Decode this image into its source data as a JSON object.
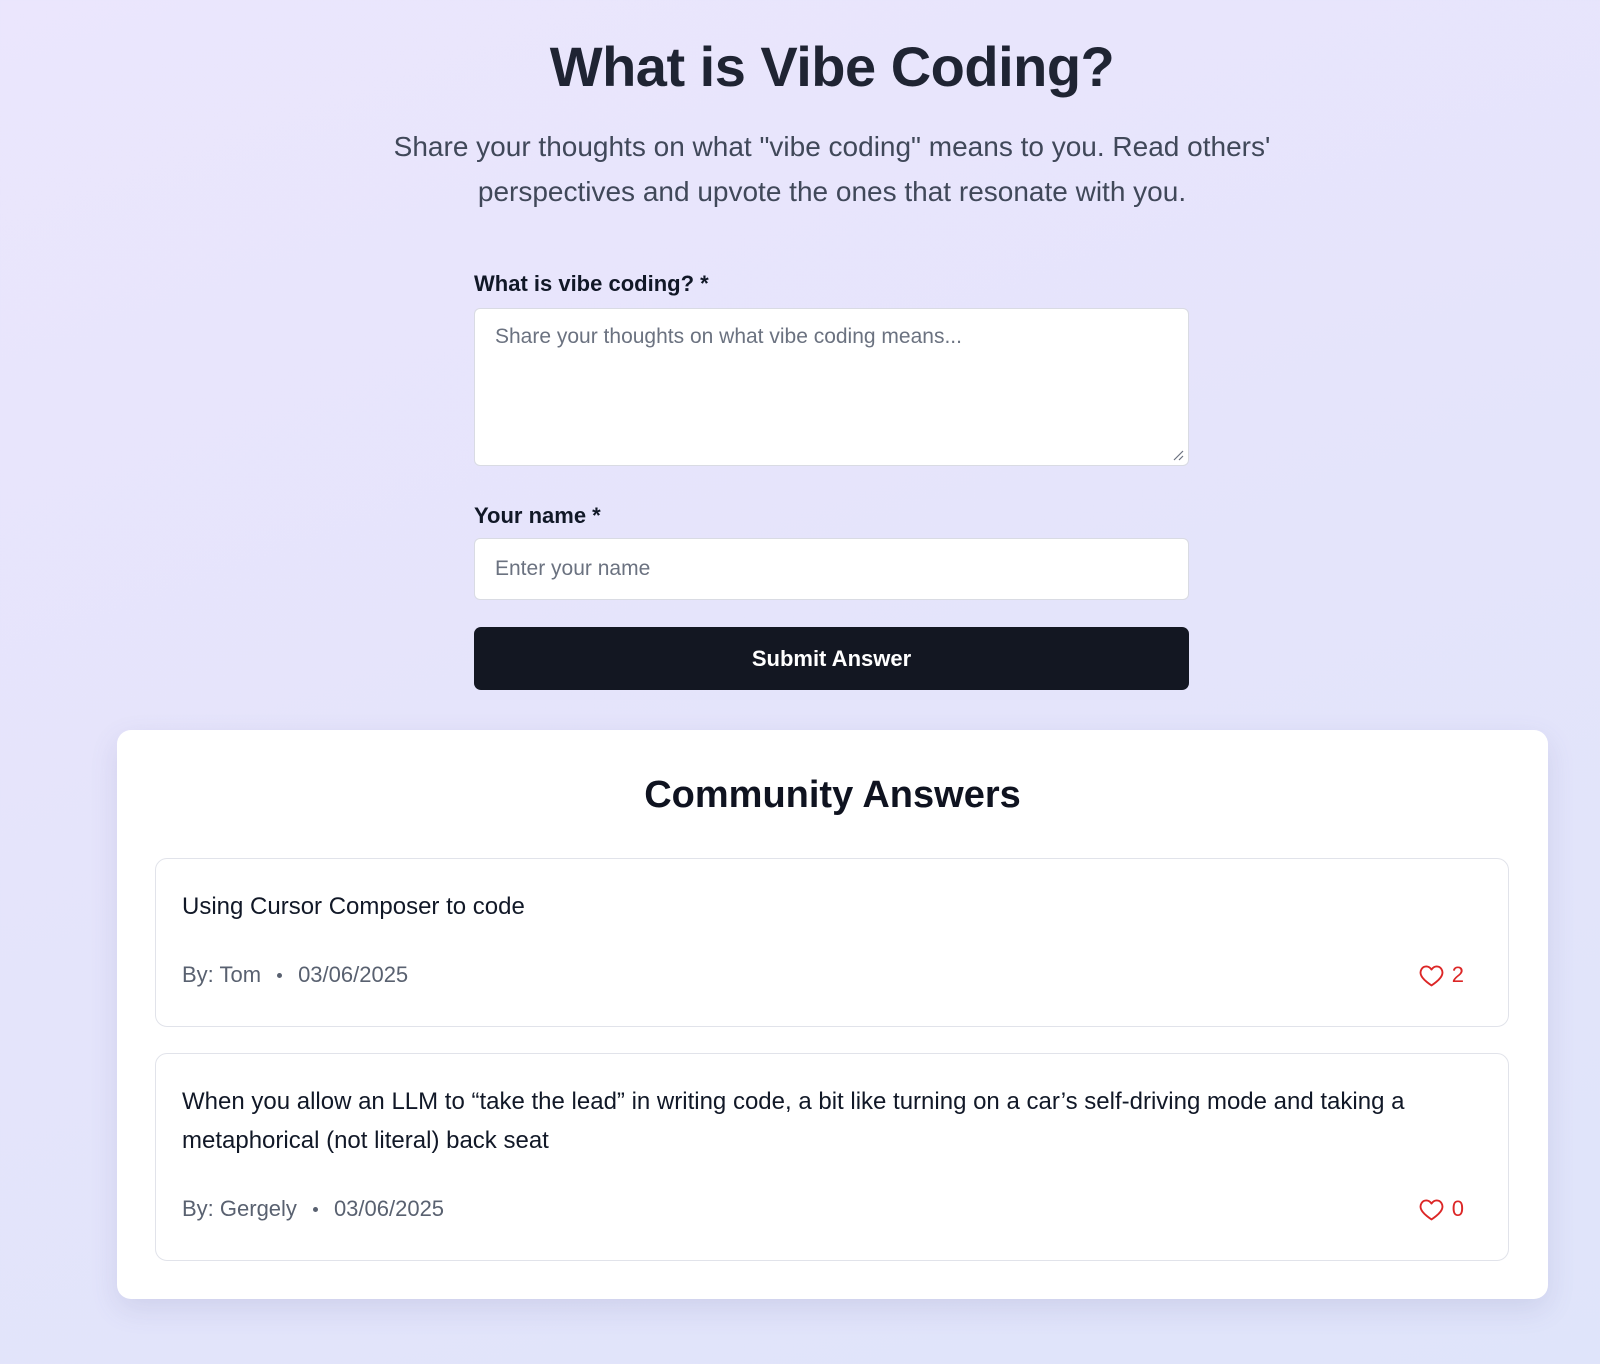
{
  "hero": {
    "title": "What is Vibe Coding?",
    "subtitle": "Share your thoughts on what \"vibe coding\" means to you. Read others' perspectives and upvote the ones that resonate with you."
  },
  "form": {
    "answer_label": "What is vibe coding? *",
    "answer_placeholder": "Share your thoughts on what vibe coding means...",
    "answer_value": "",
    "name_label": "Your name *",
    "name_placeholder": "Enter your name",
    "name_value": "",
    "submit_label": "Submit Answer"
  },
  "answers_section": {
    "title": "Community Answers",
    "items": [
      {
        "text": "Using Cursor Composer to code",
        "author": "By: Tom",
        "date": "03/06/2025",
        "likes": "2",
        "like_icon": "heart-icon"
      },
      {
        "text": "When you allow an LLM to “take the lead” in writing code, a bit like turning on a car’s self-driving mode and taking a metaphorical (not literal) back seat",
        "author": "By: Gergely",
        "date": "03/06/2025",
        "likes": "0",
        "like_icon": "heart-icon"
      }
    ]
  },
  "colors": {
    "background_start": "#ebe6fd",
    "background_end": "#dfe4fa",
    "button_bg": "#131722",
    "like_color": "#dc2626"
  }
}
